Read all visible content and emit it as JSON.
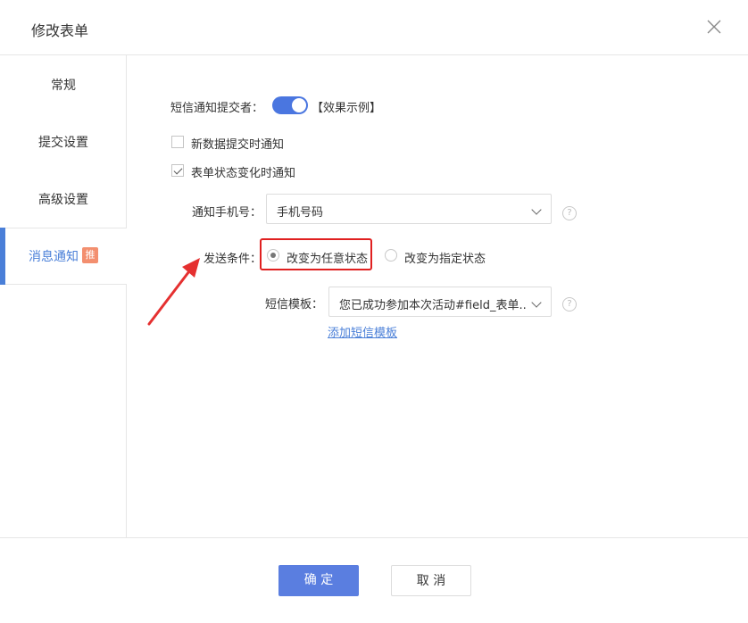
{
  "header": {
    "title": "修改表单",
    "close_icon": "close-icon"
  },
  "sidebar": {
    "items": [
      {
        "label": "常规"
      },
      {
        "label": "提交设置"
      },
      {
        "label": "高级设置"
      },
      {
        "label": "消息通知",
        "badge": "推"
      }
    ]
  },
  "form": {
    "sms_notify_label": "短信通知提交者：",
    "sms_notify_on": true,
    "example_link": "【效果示例】",
    "new_data_checkbox": {
      "label": "新数据提交时通知",
      "checked": false
    },
    "status_change_checkbox": {
      "label": "表单状态变化时通知",
      "checked": true
    },
    "phone_label": "通知手机号：",
    "phone_value": "手机号码",
    "condition_label": "发送条件：",
    "radio_any": {
      "label": "改变为任意状态",
      "checked": true
    },
    "radio_specific": {
      "label": "改变为指定状态",
      "checked": false
    },
    "template_label": "短信模板：",
    "template_value": "您已成功参加本次活动#field_表单...",
    "add_template_link": "添加短信模板",
    "help_glyph": "?"
  },
  "footer": {
    "confirm": "确 定",
    "cancel": "取 消"
  },
  "colors": {
    "accent": "#5a7ee0",
    "highlight": "#e02020",
    "badge": "#f38f6f"
  }
}
